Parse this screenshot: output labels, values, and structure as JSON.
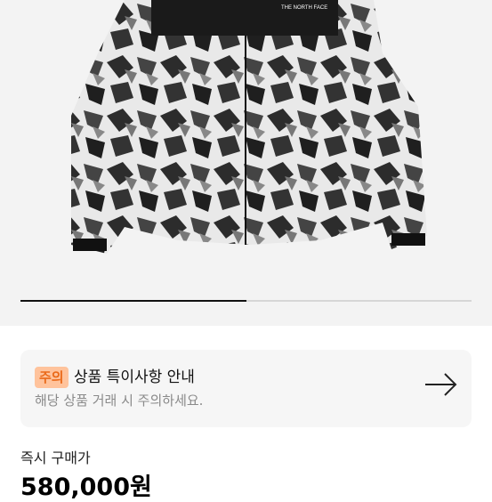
{
  "product_image": {
    "brand_logo_text": "THE NORTH FACE",
    "progress_fraction": 0.5
  },
  "notice": {
    "badge": "주의",
    "title": "상품 특이사항 안내",
    "subtitle": "해당 상품 거래 시 주의하세요.",
    "arrow_icon": "arrow-right-icon"
  },
  "price": {
    "label": "즉시 구매가",
    "value": "580,000원"
  }
}
